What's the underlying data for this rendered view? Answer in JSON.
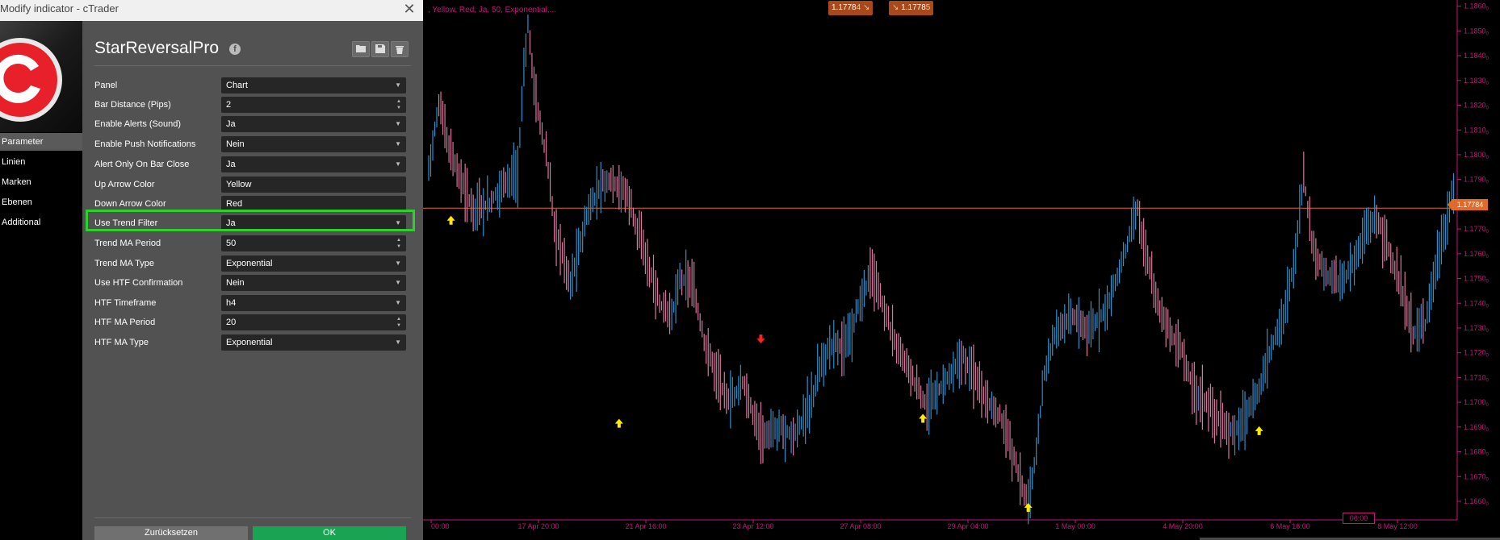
{
  "window": {
    "title": "Modify indicator - cTrader",
    "close": "✕"
  },
  "sidebar": {
    "items": [
      {
        "label": "Parameter",
        "active": true
      },
      {
        "label": "Linien",
        "active": false
      },
      {
        "label": "Marken",
        "active": false
      },
      {
        "label": "Ebenen",
        "active": false
      },
      {
        "label": "Additional",
        "active": false
      }
    ]
  },
  "indicator": {
    "name": "StarReversalPro",
    "info_icon": "f"
  },
  "params": [
    {
      "label": "Panel",
      "value": "Chart",
      "control": "select"
    },
    {
      "label": "Bar Distance (Pips)",
      "value": "2",
      "control": "spin"
    },
    {
      "label": "Enable Alerts (Sound)",
      "value": "Ja",
      "control": "select"
    },
    {
      "label": "Enable Push Notifications",
      "value": "Nein",
      "control": "select"
    },
    {
      "label": "Alert Only On Bar Close",
      "value": "Ja",
      "control": "select"
    },
    {
      "label": "Up Arrow Color",
      "value": "Yellow",
      "control": "text"
    },
    {
      "label": "Down Arrow Color",
      "value": "Red",
      "control": "text"
    },
    {
      "label": "Use Trend Filter",
      "value": "Ja",
      "control": "select"
    },
    {
      "label": "Trend MA Period",
      "value": "50",
      "control": "spin"
    },
    {
      "label": "Trend MA Type",
      "value": "Exponential",
      "control": "select"
    },
    {
      "label": "Use HTF Confirmation",
      "value": "Nein",
      "control": "select"
    },
    {
      "label": "HTF Timeframe",
      "value": "h4",
      "control": "select"
    },
    {
      "label": "HTF MA Period",
      "value": "20",
      "control": "spin"
    },
    {
      "label": "HTF MA Type",
      "value": "Exponential",
      "control": "select"
    }
  ],
  "buttons": {
    "reset": "Zurücksetzen",
    "ok": "OK"
  },
  "chart": {
    "legend": ", Yellow, Red, Ja, 50, Exponential,...",
    "bid": {
      "main": "1.1778",
      "sub": "4"
    },
    "ask": {
      "main": "1.1778",
      "sub": "5"
    },
    "current_price": "1.17784",
    "time_marker": "06:00",
    "colors": {
      "up": "#2f8fc8",
      "down": "#d8789e",
      "axis": "#c4167c",
      "price_line": "#e16a28",
      "up_arrow": "#ffeb00",
      "down_arrow": "#ff2020"
    }
  },
  "chart_data": {
    "type": "bar",
    "price_axis": {
      "ticks": [
        {
          "label": "1.1860",
          "sub": "0",
          "value": 1.186
        },
        {
          "label": "1.1850",
          "sub": "0",
          "value": 1.185
        },
        {
          "label": "1.1840",
          "sub": "0",
          "value": 1.184
        },
        {
          "label": "1.1830",
          "sub": "0",
          "value": 1.183
        },
        {
          "label": "1.1820",
          "sub": "0",
          "value": 1.182
        },
        {
          "label": "1.1810",
          "sub": "0",
          "value": 1.181
        },
        {
          "label": "1.1800",
          "sub": "0",
          "value": 1.18
        },
        {
          "label": "1.1790",
          "sub": "0",
          "value": 1.179
        },
        {
          "label": "1.1770",
          "sub": "0",
          "value": 1.177
        },
        {
          "label": "1.1760",
          "sub": "0",
          "value": 1.176
        },
        {
          "label": "1.1750",
          "sub": "0",
          "value": 1.175
        },
        {
          "label": "1.1740",
          "sub": "0",
          "value": 1.174
        },
        {
          "label": "1.1730",
          "sub": "0",
          "value": 1.173
        },
        {
          "label": "1.1720",
          "sub": "0",
          "value": 1.172
        },
        {
          "label": "1.1710",
          "sub": "0",
          "value": 1.171
        },
        {
          "label": "1.1700",
          "sub": "0",
          "value": 1.17
        },
        {
          "label": "1.1690",
          "sub": "0",
          "value": 1.169
        },
        {
          "label": "1.1680",
          "sub": "0",
          "value": 1.168
        },
        {
          "label": "1.1670",
          "sub": "0",
          "value": 1.167
        },
        {
          "label": "1.1660",
          "sub": "0",
          "value": 1.166
        }
      ]
    },
    "time_axis": {
      "labels": [
        "00:00",
        "17 Apr 20:00",
        "21 Apr 16:00",
        "23 Apr 12:00",
        "27 Apr 08:00",
        "29 Apr 04:00",
        "1 May 00:00",
        "4 May 20:00",
        "6 May 16:00",
        "8 May 12:00"
      ]
    },
    "path": [
      [
        0,
        1.1795
      ],
      [
        5,
        1.182
      ],
      [
        12,
        1.1798
      ],
      [
        18,
        1.1785
      ],
      [
        22,
        1.1778
      ],
      [
        30,
        1.178
      ],
      [
        38,
        1.179
      ],
      [
        44,
        1.1792
      ],
      [
        47,
        1.1835
      ],
      [
        49,
        1.1852
      ],
      [
        53,
        1.1822
      ],
      [
        58,
        1.18
      ],
      [
        62,
        1.1772
      ],
      [
        70,
        1.1748
      ],
      [
        78,
        1.1775
      ],
      [
        85,
        1.1788
      ],
      [
        90,
        1.179
      ],
      [
        98,
        1.1784
      ],
      [
        106,
        1.1762
      ],
      [
        114,
        1.174
      ],
      [
        120,
        1.1735
      ],
      [
        124,
        1.175
      ],
      [
        130,
        1.1748
      ],
      [
        136,
        1.1725
      ],
      [
        142,
        1.1712
      ],
      [
        148,
        1.17
      ],
      [
        155,
        1.1708
      ],
      [
        160,
        1.1695
      ],
      [
        166,
        1.1686
      ],
      [
        174,
        1.169
      ],
      [
        180,
        1.1686
      ],
      [
        188,
        1.1698
      ],
      [
        194,
        1.1716
      ],
      [
        200,
        1.1725
      ],
      [
        206,
        1.1722
      ],
      [
        212,
        1.1738
      ],
      [
        218,
        1.1752
      ],
      [
        222,
        1.1745
      ],
      [
        228,
        1.173
      ],
      [
        234,
        1.1718
      ],
      [
        240,
        1.1708
      ],
      [
        246,
        1.1698
      ],
      [
        252,
        1.1705
      ],
      [
        258,
        1.1712
      ],
      [
        264,
        1.1718
      ],
      [
        270,
        1.171
      ],
      [
        276,
        1.17
      ],
      [
        282,
        1.1695
      ],
      [
        288,
        1.168
      ],
      [
        292,
        1.1668
      ],
      [
        296,
        1.166
      ],
      [
        300,
        1.168
      ],
      [
        304,
        1.1712
      ],
      [
        310,
        1.173
      ],
      [
        318,
        1.1735
      ],
      [
        326,
        1.1728
      ],
      [
        334,
        1.1738
      ],
      [
        340,
        1.175
      ],
      [
        346,
        1.1768
      ],
      [
        350,
        1.1778
      ],
      [
        354,
        1.176
      ],
      [
        360,
        1.174
      ],
      [
        366,
        1.1728
      ],
      [
        372,
        1.172
      ],
      [
        378,
        1.1705
      ],
      [
        386,
        1.1698
      ],
      [
        392,
        1.169
      ],
      [
        398,
        1.1688
      ],
      [
        404,
        1.1695
      ],
      [
        410,
        1.1705
      ],
      [
        416,
        1.1722
      ],
      [
        422,
        1.1735
      ],
      [
        428,
        1.176
      ],
      [
        432,
        1.1792
      ],
      [
        436,
        1.1765
      ],
      [
        442,
        1.1752
      ],
      [
        450,
        1.1748
      ],
      [
        456,
        1.1755
      ],
      [
        462,
        1.1768
      ],
      [
        468,
        1.1775
      ],
      [
        474,
        1.1762
      ],
      [
        480,
        1.1745
      ],
      [
        486,
        1.1728
      ],
      [
        492,
        1.1732
      ],
      [
        496,
        1.175
      ],
      [
        502,
        1.177
      ],
      [
        506,
        1.1786
      ]
    ],
    "total_bars": 507,
    "up_arrows": [
      {
        "bar": 11,
        "price": 1.1775
      },
      {
        "bar": 94,
        "price": 1.1693
      },
      {
        "bar": 244,
        "price": 1.1695
      },
      {
        "bar": 296,
        "price": 1.1659
      },
      {
        "bar": 410,
        "price": 1.169
      }
    ],
    "down_arrows": [
      {
        "bar": 164,
        "price": 1.1727
      }
    ]
  }
}
